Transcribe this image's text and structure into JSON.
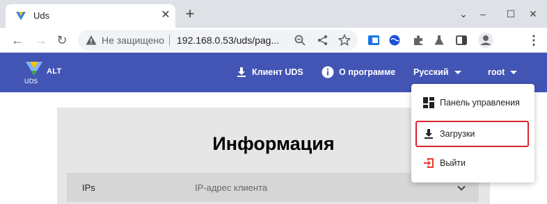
{
  "browser": {
    "tab": {
      "title": "Uds"
    },
    "address_bar": {
      "security_label": "Не защищено",
      "url": "192.168.0.53/uds/pag..."
    }
  },
  "header": {
    "brand": "ALT",
    "logo_text": "UDS",
    "nav": {
      "client": "Клиент UDS",
      "about": "О программе",
      "language": "Русский",
      "user": "root"
    }
  },
  "main": {
    "title": "Информация",
    "rows": [
      {
        "label": "IPs",
        "description": "IP-адрес клиента"
      }
    ]
  },
  "user_menu": {
    "items": [
      {
        "label": "Панель управления",
        "icon": "dashboard-icon"
      },
      {
        "label": "Загрузки",
        "icon": "download-icon",
        "highlighted": true
      },
      {
        "label": "Выйти",
        "icon": "logout-icon"
      }
    ]
  },
  "colors": {
    "appbar": "#4355b4",
    "highlight_border": "#d9232d",
    "logout_icon": "#e53935"
  }
}
